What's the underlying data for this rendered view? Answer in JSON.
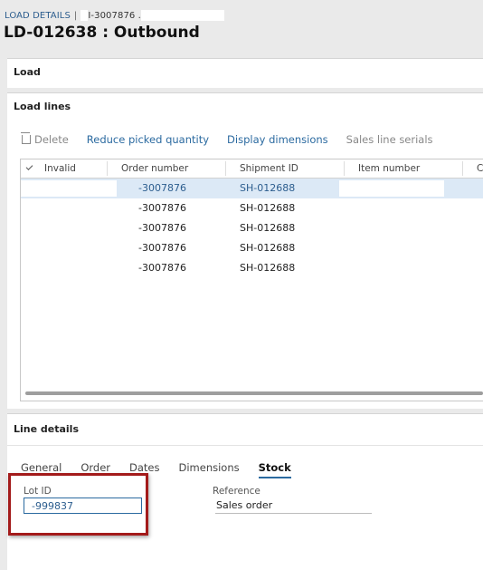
{
  "breadcrumb": {
    "link": "LOAD DETAILS",
    "separator": "|",
    "record": "I-3007876 ."
  },
  "page_title": "LD-012638 : Outbound",
  "load_section": {
    "title": "Load"
  },
  "load_lines": {
    "title": "Load lines",
    "toolbar": {
      "delete": "Delete",
      "reduce": "Reduce picked quantity",
      "dimensions": "Display dimensions",
      "serials": "Sales line serials"
    },
    "columns": [
      "Invalid",
      "Order number",
      "Shipment ID",
      "Item number",
      "C"
    ],
    "rows": [
      {
        "order": "-3007876",
        "shipment": "SH-012688",
        "selected": true
      },
      {
        "order": "-3007876",
        "shipment": "SH-012688",
        "selected": false
      },
      {
        "order": "-3007876",
        "shipment": "SH-012688",
        "selected": false
      },
      {
        "order": "-3007876",
        "shipment": "SH-012688",
        "selected": false
      },
      {
        "order": "-3007876",
        "shipment": "SH-012688",
        "selected": false
      }
    ]
  },
  "line_details": {
    "title": "Line details",
    "tabs": [
      "General",
      "Order",
      "Dates",
      "Dimensions",
      "Stock"
    ],
    "active_tab": "Stock",
    "lot_label": "Lot ID",
    "lot_value": "-999837",
    "reference_label": "Reference",
    "reference_value": "Sales order"
  },
  "colors": {
    "accent": "#2b6aa0",
    "highlight": "#a31b1b",
    "selected_row": "#dce9f6"
  }
}
